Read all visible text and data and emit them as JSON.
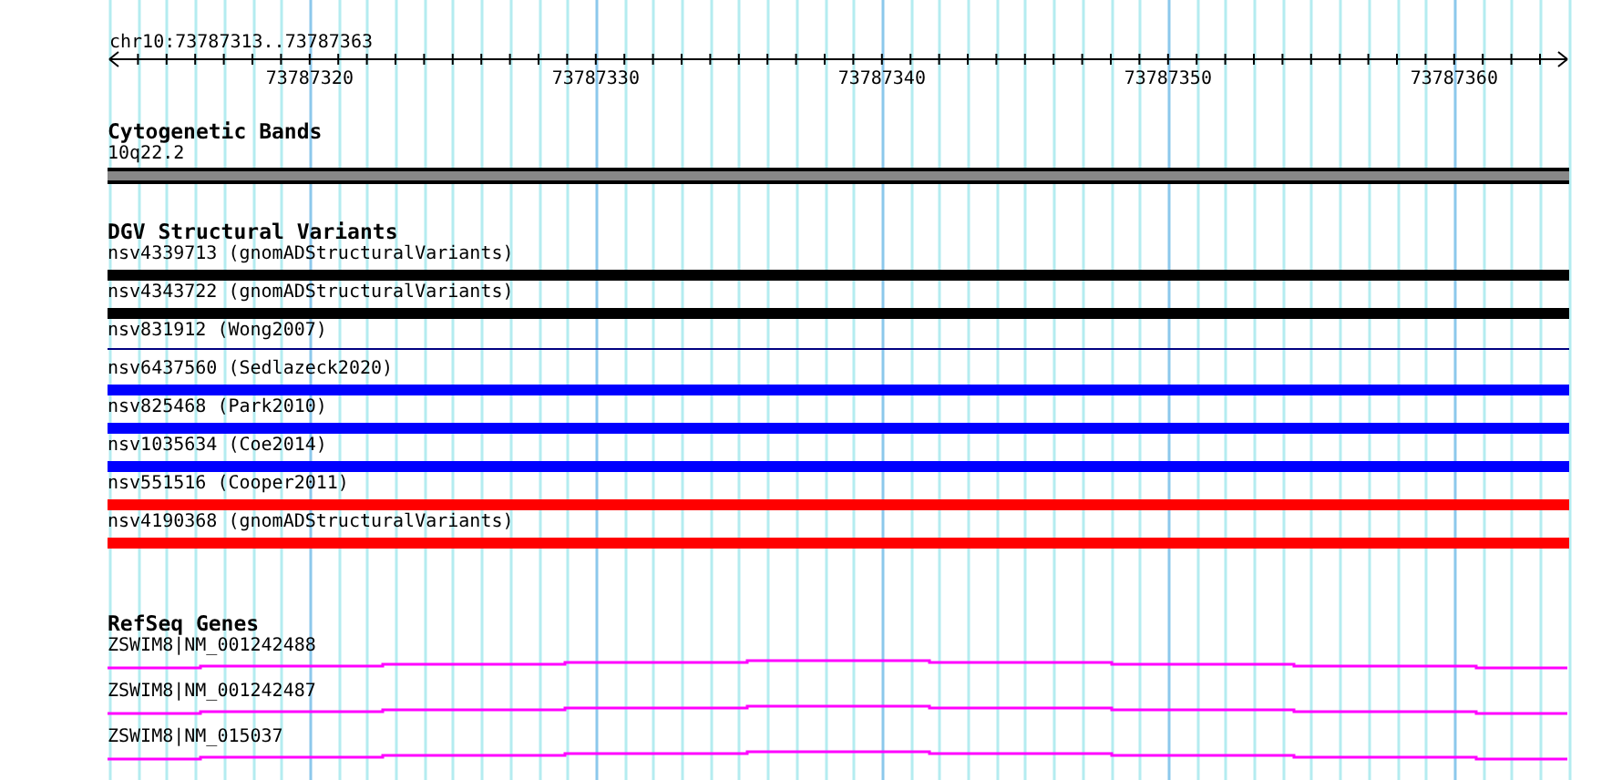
{
  "ruler": {
    "range": "chr10:73787313..73787363",
    "tick_labels": [
      "73787320",
      "73787330",
      "73787340",
      "73787350",
      "73787360"
    ]
  },
  "cytogenetic_bands": {
    "title": "Cytogenetic Bands",
    "bands": [
      {
        "name": "10q22.2"
      }
    ]
  },
  "dgv_structural_variants": {
    "title": "DGV Structural Variants",
    "items": [
      {
        "label": "nsv4339713 (gnomADStructuralVariants)",
        "kind": "bar",
        "color": "#000000"
      },
      {
        "label": "nsv4343722 (gnomADStructuralVariants)",
        "kind": "bar",
        "color": "#000000"
      },
      {
        "label": "nsv831912 (Wong2007)",
        "kind": "line",
        "color": "#000080"
      },
      {
        "label": "nsv6437560 (Sedlazeck2020)",
        "kind": "bar",
        "color": "#0000ff"
      },
      {
        "label": "nsv825468 (Park2010)",
        "kind": "bar",
        "color": "#0000ff"
      },
      {
        "label": "nsv1035634 (Coe2014)",
        "kind": "bar",
        "color": "#0000ff"
      },
      {
        "label": "nsv551516 (Cooper2011)",
        "kind": "bar",
        "color": "#ff0000"
      },
      {
        "label": "nsv4190368 (gnomADStructuralVariants)",
        "kind": "bar",
        "color": "#ff0000"
      }
    ]
  },
  "refseq_genes": {
    "title": "RefSeq Genes",
    "genes": [
      {
        "label": "ZSWIM8|NM_001242488"
      },
      {
        "label": "ZSWIM8|NM_001242487"
      },
      {
        "label": "ZSWIM8|NM_015037"
      }
    ]
  }
}
